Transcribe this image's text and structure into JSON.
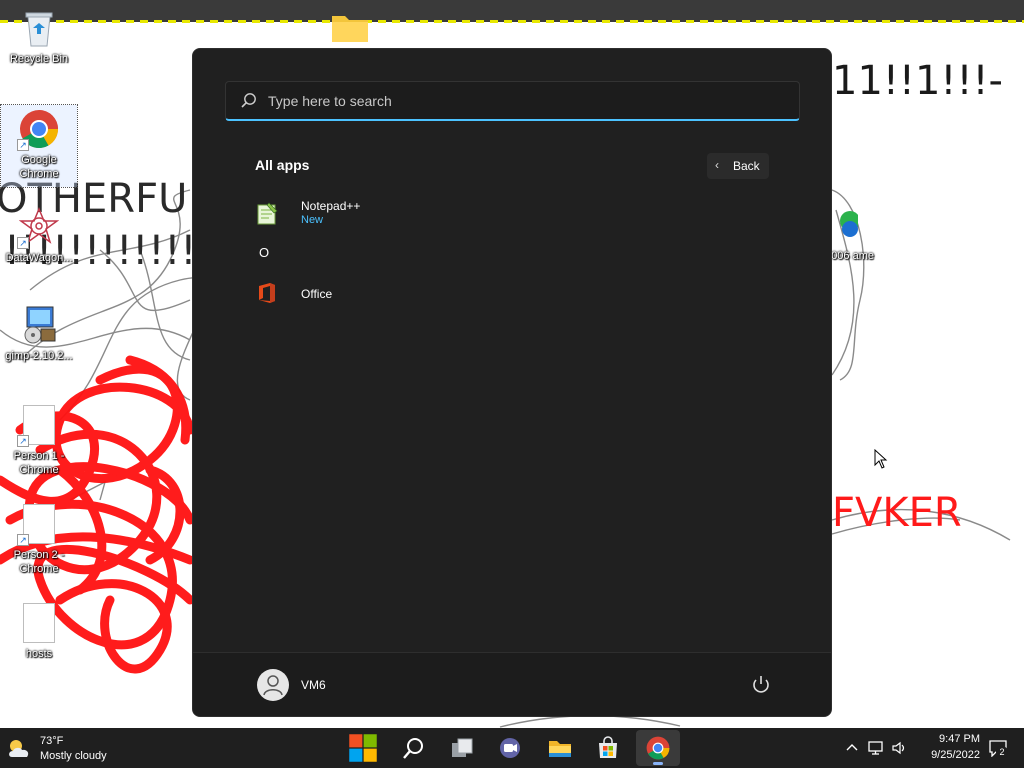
{
  "desktop": {
    "icons": [
      {
        "label": "Recycle Bin"
      },
      {
        "label": "Google Chrome"
      },
      {
        "label": "DataWagon..."
      },
      {
        "label": "gimp-2.10.2..."
      },
      {
        "label": "Person 1 - Chrome"
      },
      {
        "label": "Person 2 - Chrome"
      },
      {
        "label": "hosts"
      },
      {
        "label": "006 ame"
      }
    ],
    "wallpaper_text": {
      "top_right": "11!!1!!!-",
      "left_big": "OTHERFU",
      "left_bangs": "!!!!!!!!!!!!",
      "right_red": "FVKER"
    }
  },
  "start_menu": {
    "search": {
      "placeholder": "Type here to search",
      "value": ""
    },
    "all_apps_title": "All apps",
    "back_label": "Back",
    "apps": [
      {
        "name": "Notepad++",
        "badge": "New",
        "icon": "notepadpp-icon"
      },
      {
        "name": "Office",
        "icon": "office-icon"
      }
    ],
    "section_letter": "O",
    "user_name": "VM6"
  },
  "taskbar": {
    "weather": {
      "temp": "73°F",
      "description": "Mostly cloudy"
    },
    "pinned": [
      {
        "name": "start-button",
        "icon": "windows-logo-icon"
      },
      {
        "name": "search-button",
        "icon": "search-icon"
      },
      {
        "name": "task-view-button",
        "icon": "task-view-icon"
      },
      {
        "name": "chat-button",
        "icon": "chat-icon"
      },
      {
        "name": "file-explorer-button",
        "icon": "folder-icon"
      },
      {
        "name": "store-button",
        "icon": "store-icon"
      },
      {
        "name": "chrome-button",
        "icon": "chrome-icon",
        "active": true
      }
    ],
    "clock": {
      "time": "9:47 PM",
      "date": "9/25/2022"
    },
    "notifications_count": "2"
  },
  "colors": {
    "accent": "#4cc2ff",
    "start_bg": "#202020",
    "taskbar_bg": "#1f1f1f",
    "scribble_red": "#ff0000"
  }
}
